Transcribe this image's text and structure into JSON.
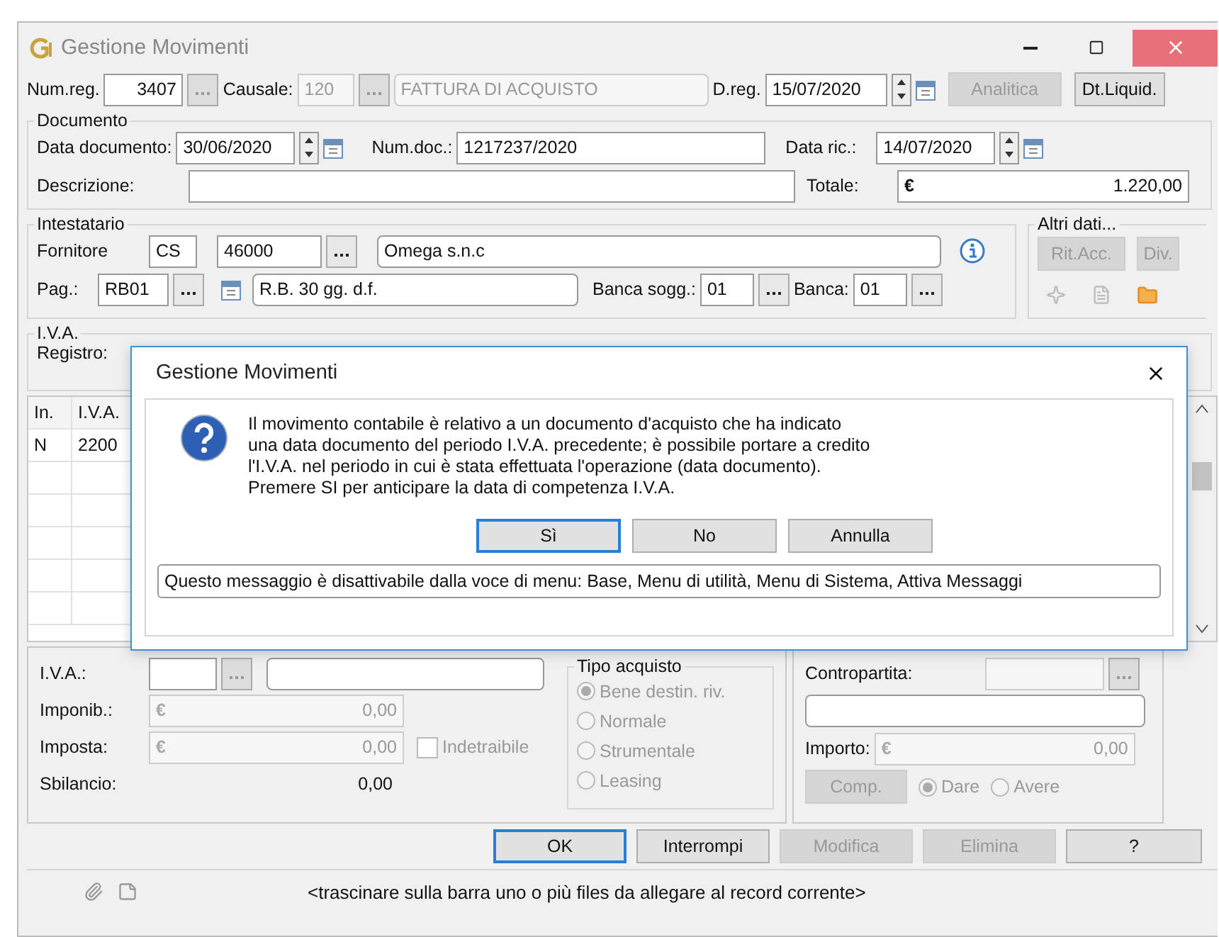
{
  "window": {
    "title": "Gestione Movimenti"
  },
  "header": {
    "num_reg_label": "Num.reg.",
    "num_reg": "3407",
    "causale_label": "Causale:",
    "causale": "120",
    "causale_desc": "FATTURA DI ACQUISTO",
    "d_reg_label": "D.reg.",
    "d_reg": "15/07/2020",
    "buttons": [
      {
        "label": "Analitica",
        "disabled": true
      },
      {
        "label": "Dt.Liquid.",
        "disabled": false
      }
    ]
  },
  "documento": {
    "title": "Documento",
    "data_label": "Data documento:",
    "data": "30/06/2020",
    "num_label": "Num.doc.:",
    "num": "1217237/2020",
    "data_ric_label": "Data ric.:",
    "data_ric": "14/07/2020",
    "descrizione_label": "Descrizione:",
    "totale_label": "Totale:",
    "currency": "€",
    "totale": "1.220,00"
  },
  "intestatario": {
    "title": "Intestatario",
    "fornitore_label": "Fornitore",
    "tipo": "CS",
    "codice": "46000",
    "ragione": "Omega s.n.c",
    "pag_label": "Pag.:",
    "pag": "RB01",
    "pag_desc": "R.B. 30 gg. d.f.",
    "banca_sogg_label": "Banca sogg.:",
    "banca_sogg": "01",
    "banca_label": "Banca:",
    "banca": "01"
  },
  "altri_dati": {
    "title": "Altri dati...",
    "buttons": [
      {
        "label": "Rit.Acc.",
        "disabled": true
      },
      {
        "label": "Div.",
        "disabled": true
      }
    ]
  },
  "iva_group": {
    "title": "I.V.A.",
    "registro_label": "Registro:"
  },
  "grid": {
    "columns": [
      "In.",
      "I.V.A."
    ],
    "rows": [
      [
        "N",
        "2200"
      ]
    ]
  },
  "iva_detail": {
    "iva_label": "I.V.A.:",
    "imponib_label": "Imponib.:",
    "imponib": "0,00",
    "imposta_label": "Imposta:",
    "imposta": "0,00",
    "currency": "€",
    "indetraibile": {
      "label": "Indetraibile",
      "checked": false
    },
    "sbilancio_label": "Sbilancio:",
    "sbilancio": "0,00"
  },
  "tipo_acquisto": {
    "title": "Tipo acquisto",
    "options": [
      {
        "label": "Bene destin. riv.",
        "selected": true
      },
      {
        "label": "Normale",
        "selected": false
      },
      {
        "label": "Strumentale",
        "selected": false
      },
      {
        "label": "Leasing",
        "selected": false
      }
    ]
  },
  "contropartita": {
    "label": "Contropartita:",
    "importo_label": "Importo:",
    "currency": "€",
    "importo": "0,00",
    "comp": "Comp.",
    "sides": [
      {
        "label": "Dare",
        "selected": true
      },
      {
        "label": "Avere",
        "selected": false
      }
    ]
  },
  "actions": [
    {
      "label": "OK",
      "default": true,
      "disabled": false
    },
    {
      "label": "Interrompi",
      "default": false,
      "disabled": false
    },
    {
      "label": "Modifica",
      "default": false,
      "disabled": true
    },
    {
      "label": "Elimina",
      "default": false,
      "disabled": true
    },
    {
      "label": "?",
      "default": false,
      "disabled": false
    }
  ],
  "status_bar": {
    "hint": "<trascinare sulla barra uno o più files da allegare al record corrente>"
  },
  "dialog": {
    "title": "Gestione Movimenti",
    "message": [
      "Il movimento contabile è relativo a un documento d'acquisto che ha indicato",
      "una data documento del periodo I.V.A. precedente; è possibile portare a credito",
      "l'I.V.A. nel periodo in cui è stata effettuata l'operazione (data documento).",
      "Premere SI per anticipare la data di competenza I.V.A."
    ],
    "buttons": [
      {
        "label": "Sì",
        "default": true
      },
      {
        "label": "No",
        "default": false
      },
      {
        "label": "Annulla",
        "default": false
      }
    ],
    "info": "Questo messaggio è disattivabile dalla voce di menu: Base, Menu di utilità, Menu di Sistema, Attiva Messaggi"
  }
}
